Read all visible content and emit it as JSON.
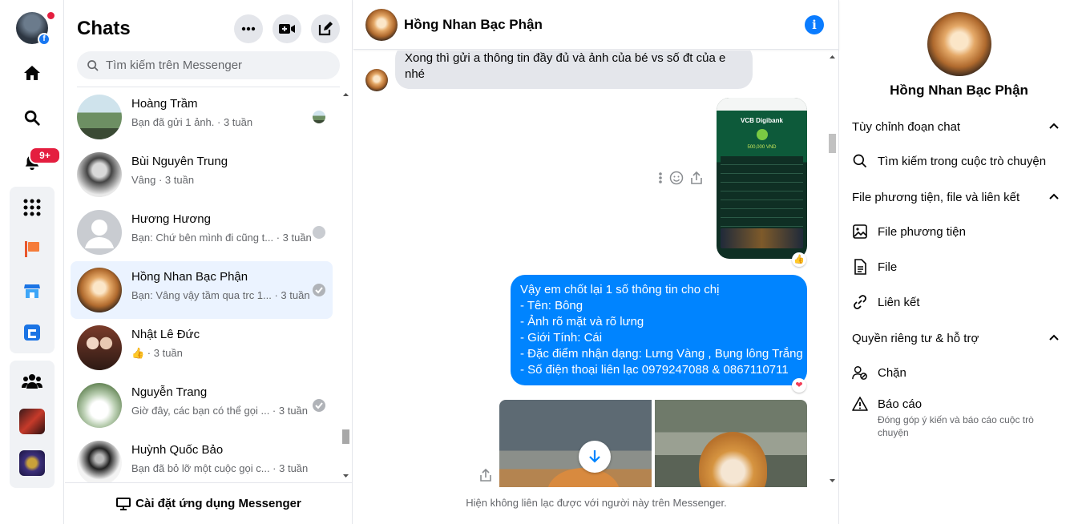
{
  "rail": {
    "notification_badge": "9+",
    "icons": [
      "home-icon",
      "search-icon",
      "bell-icon",
      "apps-grid-icon",
      "pages-flag-icon",
      "marketplace-icon",
      "gaming-icon",
      "groups-icon"
    ]
  },
  "chat_list": {
    "title": "Chats",
    "search_placeholder": "Tìm kiếm trên Messenger",
    "install_label": "Cài đặt ứng dụng Messenger",
    "items": [
      {
        "name": "Hoàng Trầm",
        "preview": "Bạn đã gửi 1 ảnh. · 3 tuần",
        "status": "seen-avatar"
      },
      {
        "name": "Bùi Nguyên Trung",
        "preview": "Vâng · 3 tuần",
        "status": ""
      },
      {
        "name": "Hương Hương",
        "preview": "Bạn: Chứ bên mình đi cũng t... · 3 tuần",
        "status": "seen-default"
      },
      {
        "name": "Hồng Nhan Bạc Phận",
        "preview": "Bạn: Vâng vậy tầm qua trc 1... · 3 tuần",
        "status": "sent",
        "active": true
      },
      {
        "name": "Nhật Lê Đức",
        "preview": "👍 · 3 tuần",
        "status": ""
      },
      {
        "name": "Nguyễn Trang",
        "preview": "Giờ đây, các bạn có thể gọi ... · 3 tuần",
        "status": "sent"
      },
      {
        "name": "Huỳnh Quốc Bảo",
        "preview": "Bạn đã bỏ lỡ một cuộc gọi c... · 3 tuần",
        "status": ""
      }
    ]
  },
  "conversation": {
    "contact_name": "Hồng Nhan Bạc Phận",
    "incoming_message": "Xong thì gửi a thông tin đầy đủ và ảnh của bé vs số đt của e nhé",
    "receipt": {
      "bank": "VCB Digibank",
      "amount": "500,000 VND"
    },
    "outgoing_lines": [
      "Vậy em chốt lại 1 số thông tin cho chị",
      "- Tên: Bông",
      "- Ảnh rõ mặt và rõ lưng",
      "- Giới Tính: Cái",
      "- Đặc điểm nhận dạng: Lưng Vàng , Bụng lông Trắng",
      "- Số điện thoại liên lạc 0979247088 & 0867110711"
    ],
    "footer": "Hiện không liên lạc được với người này trên Messenger."
  },
  "info_panel": {
    "name": "Hồng Nhan Bạc Phận",
    "sections": {
      "customize": "Tùy chỉnh đoạn chat",
      "search": "Tìm kiếm trong cuộc trò chuyện",
      "media_header": "File phương tiện, file và liên kết",
      "media": "File phương tiện",
      "files": "File",
      "links": "Liên kết",
      "privacy_header": "Quyền riêng tư & hỗ trợ",
      "block": "Chặn",
      "report": "Báo cáo",
      "report_sub": "Đóng góp ý kiến và báo cáo cuộc trò chuyện"
    }
  },
  "colors": {
    "accent": "#0084ff",
    "active_row": "#ebf3ff",
    "badge": "#e41e3f"
  }
}
